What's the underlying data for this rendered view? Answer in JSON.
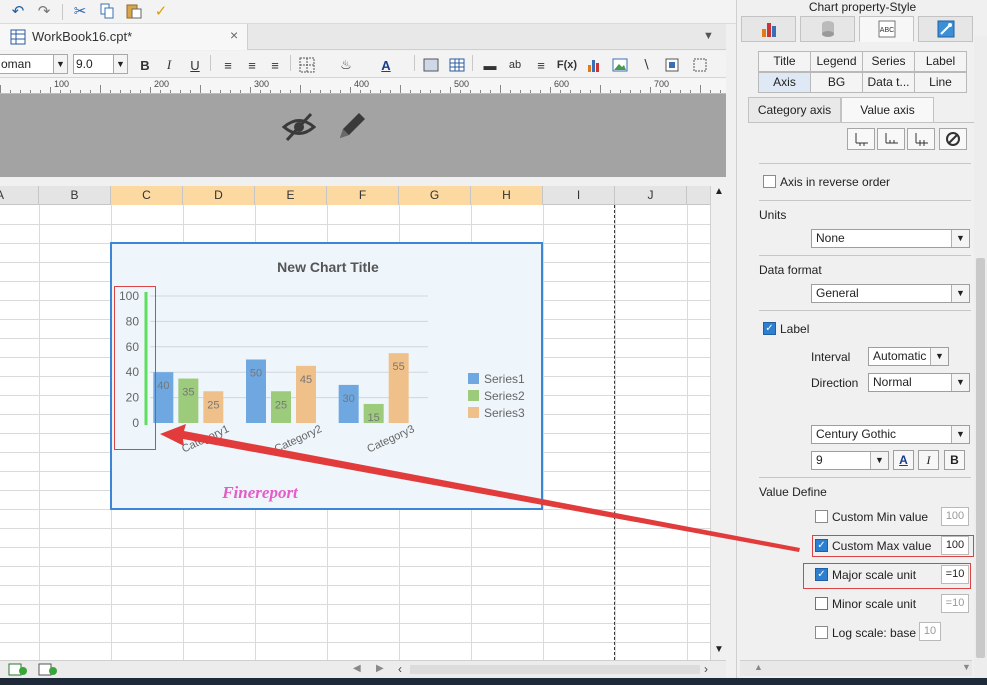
{
  "app": {
    "document_tab": "WorkBook16.cpt*",
    "font_name": "oman",
    "font_size": "9.0"
  },
  "ruler": {
    "labels": [
      "100",
      "200",
      "300",
      "400",
      "500",
      "600",
      "700"
    ]
  },
  "sheet": {
    "columns": [
      "A",
      "B",
      "C",
      "D",
      "E",
      "F",
      "G",
      "H",
      "I",
      "J"
    ],
    "selected_columns": [
      "C",
      "D",
      "E",
      "F",
      "G",
      "H"
    ]
  },
  "chart_data": {
    "type": "bar",
    "title": "New Chart Title",
    "watermark": "Finereport",
    "categories": [
      "Category1",
      "Category2",
      "Category3"
    ],
    "series": [
      {
        "name": "Series1",
        "values": [
          40,
          50,
          30
        ],
        "color": "#6fa8e0"
      },
      {
        "name": "Series2",
        "values": [
          35,
          25,
          15
        ],
        "color": "#9ccb7c"
      },
      {
        "name": "Series3",
        "values": [
          25,
          45,
          55
        ],
        "color": "#f0c08a"
      }
    ],
    "yticks": [
      "100",
      "80",
      "60",
      "40",
      "20",
      "0"
    ],
    "ylim": [
      0,
      100
    ],
    "grid": true,
    "legend_position": "right",
    "data_labels": true
  },
  "panel": {
    "title": "Chart property-Style",
    "tabs_row1": [
      "Title",
      "Legend",
      "Series",
      "Label"
    ],
    "tabs_row2": [
      "Axis",
      "BG",
      "Data t...",
      "Line"
    ],
    "active_tab": "Axis",
    "sub_tabs": [
      "Category axis",
      "Value axis"
    ],
    "active_sub_tab": "Value axis",
    "reverse_order_label": "Axis in reverse order",
    "units_label": "Units",
    "units_value": "None",
    "data_format_label": "Data format",
    "data_format_value": "General",
    "label_checkbox": "Label",
    "interval_label": "Interval",
    "interval_value": "Automatic",
    "direction_label": "Direction",
    "direction_value": "Normal",
    "font_value": "Century Gothic",
    "font_size_value": "9",
    "value_define_label": "Value Define",
    "custom_min_label": "Custom Min value",
    "custom_min_value": "100",
    "custom_max_label": "Custom Max value",
    "custom_max_value": "100",
    "major_unit_label": "Major scale unit",
    "major_unit_value": "=10",
    "minor_unit_label": "Minor scale unit",
    "minor_unit_value": "=10",
    "log_scale_label": "Log scale: base",
    "log_scale_value": "10"
  }
}
